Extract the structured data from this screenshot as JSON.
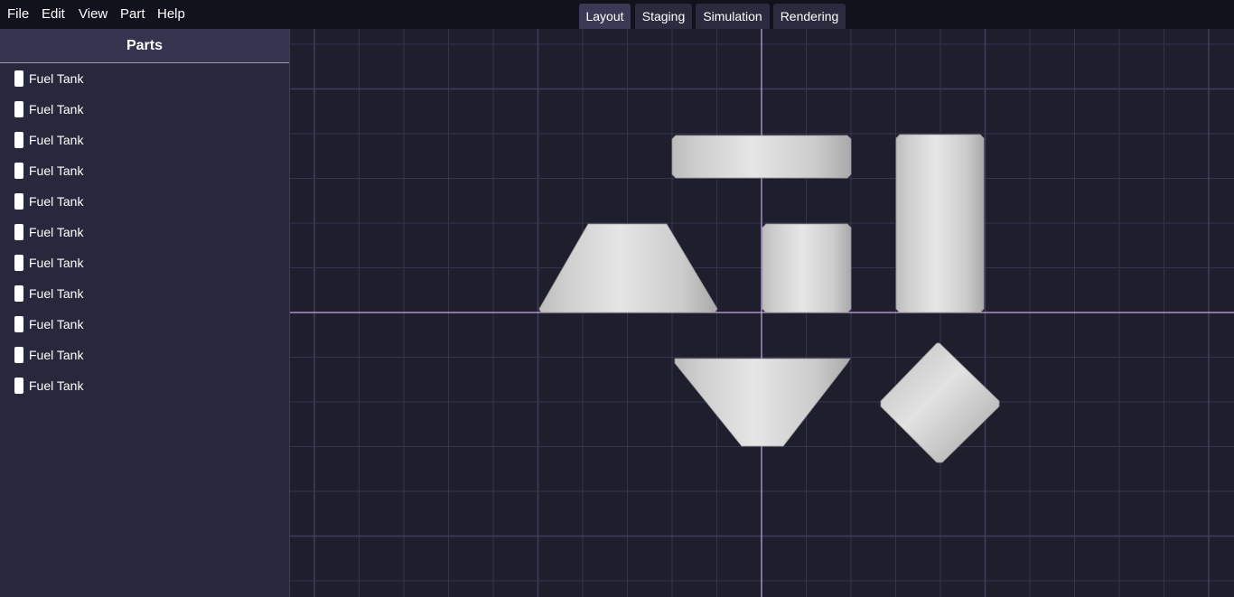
{
  "menu": {
    "file": "File",
    "edit": "Edit",
    "view": "View",
    "part": "Part",
    "help": "Help"
  },
  "tabs": {
    "layout": "Layout",
    "staging": "Staging",
    "simulation": "Simulation",
    "rendering": "Rendering",
    "active": "Layout"
  },
  "sidebar": {
    "title": "Parts",
    "items": [
      {
        "label": "Fuel Tank"
      },
      {
        "label": "Fuel Tank"
      },
      {
        "label": "Fuel Tank"
      },
      {
        "label": "Fuel Tank"
      },
      {
        "label": "Fuel Tank"
      },
      {
        "label": "Fuel Tank"
      },
      {
        "label": "Fuel Tank"
      },
      {
        "label": "Fuel Tank"
      },
      {
        "label": "Fuel Tank"
      },
      {
        "label": "Fuel Tank"
      },
      {
        "label": "Fuel Tank"
      }
    ],
    "item_icon": "fuel-tank-icon"
  },
  "viewport": {
    "parts": [
      {
        "shape": "horizontal-cylinder"
      },
      {
        "shape": "tall-cylinder"
      },
      {
        "shape": "cone-up"
      },
      {
        "shape": "short-cylinder"
      },
      {
        "shape": "cone-down"
      },
      {
        "shape": "rotated-cylinder"
      }
    ],
    "colors": {
      "grid_minor": "#34344d",
      "grid_major": "#3f3f5c",
      "axis": "#c9a8e8",
      "part": "#d4d4d4"
    }
  }
}
